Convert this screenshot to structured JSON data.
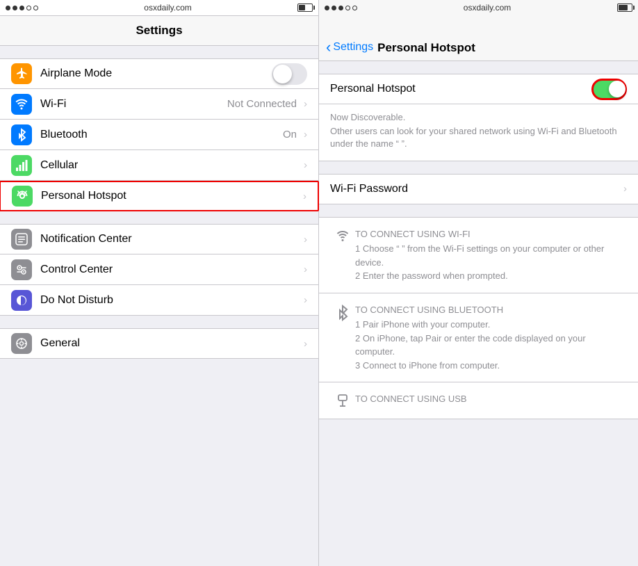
{
  "left": {
    "statusBar": {
      "domain": "osxdaily.com",
      "dots": [
        true,
        true,
        true,
        false,
        false
      ]
    },
    "navTitle": "Settings",
    "rows": [
      {
        "id": "airplane",
        "label": "Airplane Mode",
        "iconBg": "#ff9500",
        "iconType": "airplane",
        "hasToggle": true,
        "toggleOn": false,
        "value": "",
        "hasChevron": false
      },
      {
        "id": "wifi",
        "label": "Wi-Fi",
        "iconBg": "#007aff",
        "iconType": "wifi",
        "hasToggle": false,
        "value": "Not Connected",
        "hasChevron": true
      },
      {
        "id": "bluetooth",
        "label": "Bluetooth",
        "iconBg": "#007aff",
        "iconType": "bluetooth",
        "hasToggle": false,
        "value": "On",
        "hasChevron": true
      },
      {
        "id": "cellular",
        "label": "Cellular",
        "iconBg": "#4cd964",
        "iconType": "cellular",
        "hasToggle": false,
        "value": "",
        "hasChevron": true
      },
      {
        "id": "hotspot",
        "label": "Personal Hotspot",
        "iconBg": "#4cd964",
        "iconType": "hotspot",
        "hasToggle": false,
        "value": "",
        "hasChevron": true,
        "highlighted": true
      }
    ],
    "rows2": [
      {
        "id": "notification",
        "label": "Notification Center",
        "iconBg": "#8e8e93",
        "iconType": "notification",
        "hasChevron": true
      },
      {
        "id": "control",
        "label": "Control Center",
        "iconBg": "#8e8e93",
        "iconType": "control",
        "hasChevron": true
      },
      {
        "id": "dnd",
        "label": "Do Not Disturb",
        "iconBg": "#5856d6",
        "iconType": "dnd",
        "hasChevron": true
      }
    ],
    "rows3": [
      {
        "id": "general",
        "label": "General",
        "iconBg": "#8e8e93",
        "iconType": "general",
        "hasChevron": true
      }
    ]
  },
  "right": {
    "statusBar": {
      "domain": "osxdaily.com"
    },
    "backLabel": "Settings",
    "navTitle": "Personal Hotspot",
    "hotspotLabel": "Personal Hotspot",
    "hotspotOn": true,
    "discoverableTitle": "Now Discoverable.",
    "discoverableBody": "Other users can look for your shared network using Wi-Fi and Bluetooth under the name “                ”.",
    "wifiPasswordLabel": "Wi-Fi Password",
    "connectSections": [
      {
        "id": "wifi",
        "title": "TO CONNECT USING WI-FI",
        "steps": [
          "1 Choose “               ” from the Wi-Fi settings on your computer or other device.",
          "2 Enter the password when prompted."
        ],
        "iconType": "wifi"
      },
      {
        "id": "bluetooth",
        "title": "TO CONNECT USING BLUETOOTH",
        "steps": [
          "1 Pair iPhone with your computer.",
          "2 On iPhone, tap Pair or enter the code displayed on your computer.",
          "3 Connect to iPhone from computer."
        ],
        "iconType": "bluetooth"
      },
      {
        "id": "usb",
        "title": "TO CONNECT USING USB",
        "steps": [],
        "iconType": "usb"
      }
    ]
  }
}
